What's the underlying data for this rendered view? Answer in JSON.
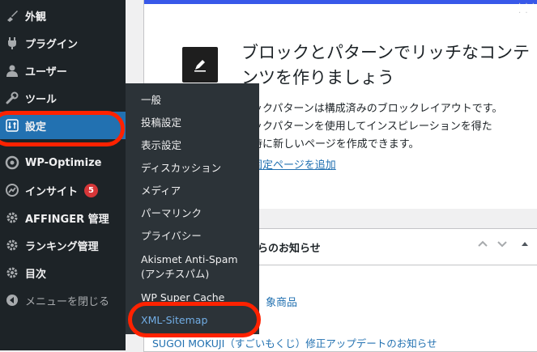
{
  "sidebar": {
    "items": [
      {
        "label": "外観",
        "icon": "paintbrush-icon"
      },
      {
        "label": "プラグイン",
        "icon": "plugin-icon"
      },
      {
        "label": "ユーザー",
        "icon": "user-icon"
      },
      {
        "label": "ツール",
        "icon": "wrench-icon"
      },
      {
        "label": "設定",
        "icon": "settings-icon",
        "active": true
      },
      {
        "label": "WP-Optimize",
        "icon": "wp-optimize-icon"
      },
      {
        "label": "インサイト",
        "icon": "insights-icon",
        "badge": "5"
      },
      {
        "label": "AFFINGER 管理",
        "icon": "gear-icon"
      },
      {
        "label": "ランキング管理",
        "icon": "gear-icon"
      },
      {
        "label": "目次",
        "icon": "gear-icon"
      },
      {
        "label": "メニューを閉じる",
        "icon": "collapse-icon"
      }
    ]
  },
  "submenu": {
    "items": [
      {
        "label": "一般"
      },
      {
        "label": "投稿設定"
      },
      {
        "label": "表示設定"
      },
      {
        "label": "ディスカッション"
      },
      {
        "label": "メディア"
      },
      {
        "label": "パーマリンク"
      },
      {
        "label": "プライバシー"
      },
      {
        "label": "Akismet Anti-Spam\n(アンチスパム)"
      },
      {
        "label": "WP Super Cache"
      },
      {
        "label": "XML-Sitemap",
        "current": true
      }
    ]
  },
  "main": {
    "headline": "ブロックとパターンでリッチなコンテンツを作りましょう",
    "description": "ロックパターンは構成済みのブロックレイアウトです。\nロックパターンを使用してインスピレーションを得た\n瞬時に新しいページを作成できます。",
    "add_link": "規固定ページを追加",
    "news_title": "らのお知らせ",
    "news_link1": "象商品",
    "news_link2": "SUGOI MOKUJI（すごいもくじ）修正アップデートのお知らせ"
  },
  "colors": {
    "sidebar_bg": "#1d2327",
    "submenu_bg": "#2c3338",
    "active_bg": "#2271b1",
    "link": "#2271b1",
    "accent_strip": "#3858e9",
    "annotation": "#ff2200",
    "badge": "#d63638"
  }
}
